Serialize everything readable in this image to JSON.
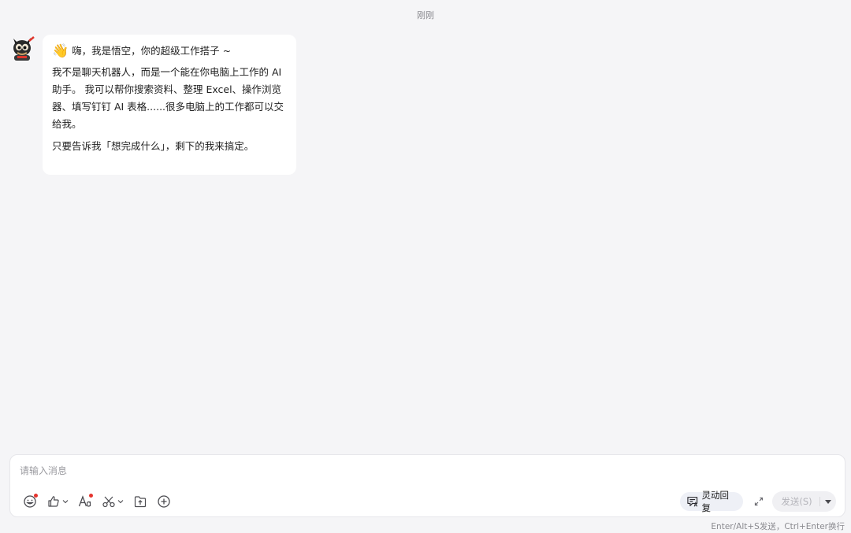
{
  "chat": {
    "timestamp": "刚刚",
    "message": {
      "emoji": "👋",
      "greeting": "嗨，我是悟空，你的超级工作搭子 ~",
      "para1": "我不是聊天机器人，而是一个能在你电脑上工作的 AI 助手。 我可以帮你搜索资料、整理 Excel、操作浏览器、填写钉钉 AI 表格......很多电脑上的工作都可以交给我。",
      "para2": "只要告诉我「想完成什么」，剩下的我来搞定。"
    }
  },
  "input": {
    "placeholder": "请输入消息",
    "value": ""
  },
  "toolbar": {
    "icons": [
      "emoji-icon",
      "thumbs-up-icon",
      "font-icon",
      "scissors-icon",
      "upload-file-icon",
      "plus-circle-icon"
    ],
    "smart_reply_label": "灵动回复",
    "send_label": "发送(S)",
    "hint": "Enter/Alt+S发送，Ctrl+Enter换行"
  },
  "colors": {
    "background": "#f5f5f7",
    "bubble": "#ffffff",
    "notification_dot": "#e5342e",
    "send_disabled_text": "#b4b4ba"
  }
}
